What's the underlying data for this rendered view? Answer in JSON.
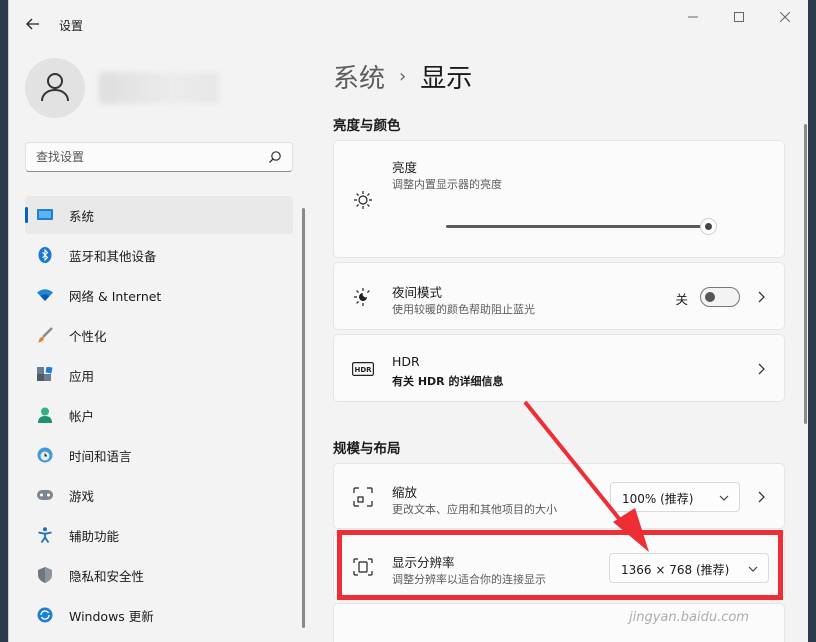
{
  "window": {
    "title": "设置",
    "back_icon": "back-arrow-icon",
    "controls": [
      "minimize-icon",
      "maximize-icon",
      "close-icon"
    ]
  },
  "sidebar": {
    "search": {
      "placeholder": "查找设置",
      "value": ""
    },
    "items": [
      {
        "label": "系统",
        "icon": "monitor-icon",
        "active": true
      },
      {
        "label": "蓝牙和其他设备",
        "icon": "bluetooth-icon"
      },
      {
        "label": "网络 & Internet",
        "icon": "wifi-icon"
      },
      {
        "label": "个性化",
        "icon": "brush-icon"
      },
      {
        "label": "应用",
        "icon": "apps-icon"
      },
      {
        "label": "帐户",
        "icon": "person-icon"
      },
      {
        "label": "时间和语言",
        "icon": "clock-globe-icon"
      },
      {
        "label": "游戏",
        "icon": "gamepad-icon"
      },
      {
        "label": "辅助功能",
        "icon": "accessibility-icon"
      },
      {
        "label": "隐私和安全性",
        "icon": "shield-icon"
      },
      {
        "label": "Windows 更新",
        "icon": "update-icon"
      }
    ]
  },
  "main": {
    "breadcrumb": {
      "parent": "系统",
      "separator": "›",
      "current": "显示"
    },
    "section_brightness": "亮度与颜色",
    "brightness": {
      "title": "亮度",
      "subtitle": "调整内置显示器的亮度",
      "level": 1.0
    },
    "night_light": {
      "title": "夜间模式",
      "subtitle": "使用较暖的颜色帮助阻止蓝光",
      "state": "关"
    },
    "hdr": {
      "title": "HDR",
      "subtitle": "有关 HDR 的详细信息"
    },
    "section_layout": "规模与布局",
    "scale": {
      "title": "缩放",
      "subtitle": "更改文本、应用和其他项目的大小",
      "value": "100% (推荐)"
    },
    "resolution": {
      "title": "显示分辨率",
      "subtitle": "调整分辨率以适合你的连接显示",
      "value": "1366 × 768 (推荐)"
    }
  },
  "watermark": "jingyan.baidu.com",
  "colors": {
    "accent": "#0067c0",
    "highlight": "#ee2e35"
  }
}
